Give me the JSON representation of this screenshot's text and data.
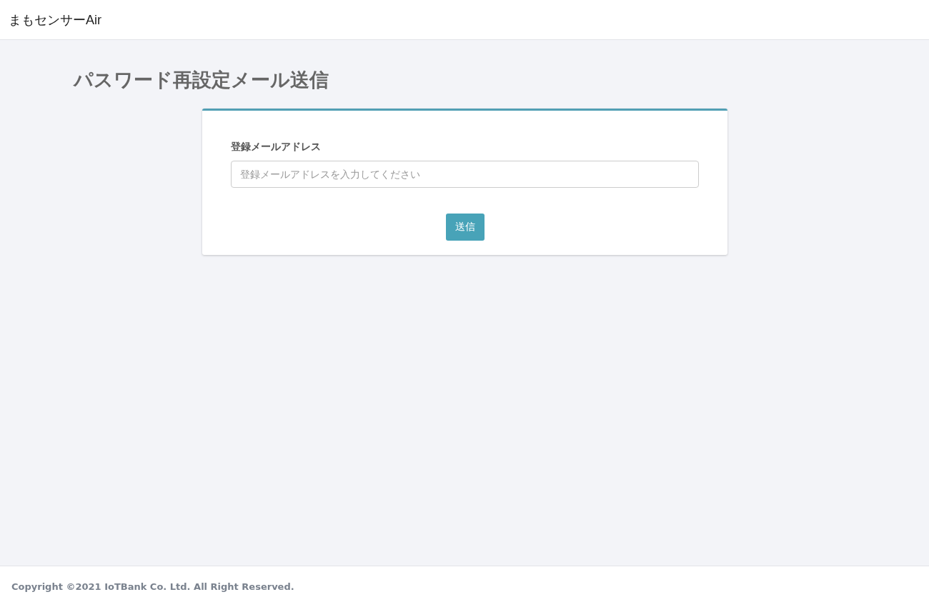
{
  "header": {
    "brand": "まもセンサーAir"
  },
  "page": {
    "title": "パスワード再設定メール送信"
  },
  "form": {
    "field": {
      "label": "登録メールアドレス",
      "placeholder": "登録メールアドレスを入力してください"
    },
    "submit": "送信"
  },
  "footer": {
    "copyright": "Copyright ©2021 IoTBank Co. Ltd. All Right Reserved."
  }
}
